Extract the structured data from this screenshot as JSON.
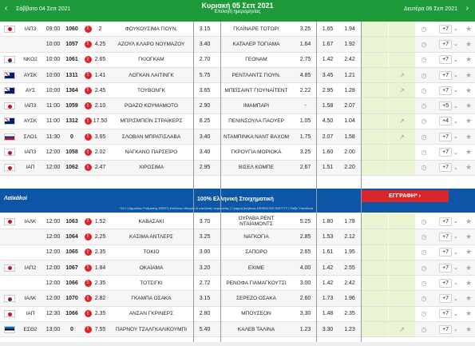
{
  "header": {
    "prev_day": "Σάββατο 04 Σεπ 2021",
    "current_day": "Κυριακή 05 Σεπ 2021",
    "subtitle": "Επιλογή ημερομηνίας",
    "next_day": "Δευτέρα 06 Σεπ 2021",
    "prev_arrow": "‹",
    "next_arrow": "›"
  },
  "rows_top": [
    {
      "flag": "jp",
      "league": "ΙΑΠ3",
      "time": "09:00",
      "code": "1060",
      "cnt": "2",
      "home": "ΦΟΥΚΟΥΣΙΜΑ ΓΙΟΥΝ.",
      "o1": "3.15",
      "away": "ΓΚΑΪΝΑΡΕ ΤΟΤΟΡΙ",
      "ox": "3.25",
      "o2": "1.65",
      "o3": "1.94",
      "pick": "",
      "more": "+7"
    },
    {
      "flag": "",
      "league": "",
      "time": "10:00",
      "code": "1057",
      "cnt": "4.25",
      "home": "ΑΖΟΥΛ ΚΛΑΡΟ ΝΟΥΜΑΖΟΥ",
      "o1": "3.40",
      "away": "ΚΑΤΑΛΕΡ ΤΟΓΙΑΜΑ",
      "ox": "1.64",
      "o2": "1.67",
      "o3": "1.92",
      "pick": "",
      "more": "+7"
    },
    {
      "flag": "kr",
      "league": "ΝΚΟ2",
      "time": "10:00",
      "code": "1061",
      "cnt": "2.65",
      "home": "ΓΚΙΟΓΚΑΜ",
      "o1": "2.70",
      "away": "ΓΕΟΝΑΜ",
      "ox": "2.75",
      "o2": "1.42",
      "o3": "2.42",
      "pick": "",
      "more": "+7"
    },
    {
      "flag": "au",
      "league": "ΑΥΣΚ",
      "time": "10:00",
      "code": "1311",
      "cnt": "1.41",
      "home": "ΛΟΓΚΑΝ ΛΑΙΤΙΝΓΚ",
      "o1": "5.75",
      "away": "ΡΕΝΤΛΑΝΤΣ ΓΙΟΥΝ.",
      "ox": "4.85",
      "o2": "3.45",
      "o3": "1.21",
      "pick": "↗",
      "more": "+7"
    },
    {
      "flag": "au",
      "league": "ΑΥΣ",
      "time": "10:00",
      "code": "1364",
      "cnt": "2.45",
      "home": "ΤΟΥΒΟΝΓΚ",
      "o1": "3.65",
      "away": "ΜΠΕΪΣΑΙΝΤ ΓΙΟΥΝΑΪΤΕΝΤ",
      "ox": "2.22",
      "o2": "2.95",
      "o3": "1.28",
      "pick": "↗",
      "more": "+7"
    },
    {
      "flag": "jp",
      "league": "ΙΑΠ3",
      "time": "11:00",
      "code": "1059",
      "cnt": "2.10",
      "home": "ΡΟΑΖΟ ΚΟΥΜΑΜΟΤΟ",
      "o1": "2.90",
      "away": "ΙΜΑΜΠΑΡΙ",
      "ox": "-",
      "o2": "1.58",
      "o3": "2.07",
      "pick": "",
      "more": "+5"
    },
    {
      "flag": "au",
      "league": "ΑΥΣΚ",
      "time": "11:00",
      "code": "1312",
      "cnt": "17.50",
      "home": "ΜΠΡΙΣΜΠΕΪΝ ΣΤΡΑΪΚΕΡΣ",
      "o1": "8.25",
      "away": "ΠΕΝΙΝΣΟΥΛΑ ΠΑΟΥΕΡ",
      "ox": "1.05",
      "o2": "4.50",
      "o3": "1.04",
      "pick": "↗",
      "more": "+4"
    },
    {
      "flag": "si",
      "league": "ΣΛΟ1",
      "time": "11:30",
      "code": "0",
      "cnt": "3.65",
      "home": "ΣΛΟΒΑΝ ΜΠΡΑΤΙΣΛΑΒΑ",
      "o1": "3.40",
      "away": "ΝΤΑΜΠΙΝΚΑ ΝΑΝΤ ΒΑΧΟΜ",
      "ox": "1.75",
      "o2": "2.07",
      "o3": "1.58",
      "pick": "↗",
      "more": "+7"
    },
    {
      "flag": "jp",
      "league": "ΙΑΠ3",
      "time": "12:00",
      "code": "1058",
      "cnt": "2.02",
      "home": "ΝΑΓΚΑΝΟ ΠΑΡΣΕΪΡΟ",
      "o1": "3.40",
      "away": "ΓΚΡΟΥΓΙΑ ΜΟΡΙΟΚΑ",
      "ox": "3.25",
      "o2": "1.60",
      "o3": "2.00",
      "pick": "",
      "more": "+7"
    },
    {
      "flag": "jp",
      "league": "ΙΑΠ",
      "time": "12:00",
      "code": "1062",
      "cnt": "2.47",
      "home": "ΧΙΡΟΣΙΜΑ",
      "o1": "2.95",
      "away": "ΒΙΣΕΛ ΚΟΜΠΕ",
      "ox": "2.67",
      "o2": "1.51",
      "o3": "2.20",
      "pick": "",
      "more": "+7"
    }
  ],
  "banner": {
    "logo": "Λαϊκάkoi",
    "message": "100% Ελληνική Στοιχηματική",
    "register": "ΕΓΓΡΑΦΗ* ›",
    "fine_print": "*21+ | Αρμόδιος Ρυθμιστής ΕΕΕΠ | Κίνδυνος εθισμού & απώλειας περιουσίας | Γραμμή βοήθειας ΚΕΘΕΑ 210 9237777 | Παίξε Υπεύθυνα"
  },
  "rows_bottom": [
    {
      "flag": "jp",
      "league": "ΙΑΛΚ",
      "time": "12:00",
      "code": "1063",
      "cnt": "1.52",
      "home": "ΚΑΒΑΣΑΚΙ",
      "o1": "3.70",
      "away": "ΟΥΡΑΒΑ ΡΕΝΤ ΝΤΑΪΑΜΟΝΤΣ",
      "ox": "5.25",
      "o2": "1.80",
      "o3": "1.78",
      "pick": "",
      "more": "+7"
    },
    {
      "flag": "",
      "league": "",
      "time": "12:00",
      "code": "1064",
      "cnt": "2.25",
      "home": "ΚΑΣΙΜΑ ΑΝΤΛΕΡΣ",
      "o1": "3.25",
      "away": "ΝΑΓΚΟΓΙΑ",
      "ox": "2.85",
      "o2": "1.53",
      "o3": "2.12",
      "pick": "",
      "more": "+7"
    },
    {
      "flag": "",
      "league": "",
      "time": "12:00",
      "code": "1065",
      "cnt": "2.35",
      "home": "ΤΟΚΙΟ",
      "o1": "3.00",
      "away": "ΣΑΠΟΡΟ",
      "ox": "2.65",
      "o2": "1.61",
      "o3": "1.95",
      "pick": "",
      "more": "+7"
    },
    {
      "flag": "jp",
      "league": "ΙΑΠ2",
      "time": "12:00",
      "code": "1067",
      "cnt": "1.84",
      "home": "ΟΚΑΪΑΜΑ",
      "o1": "3.20",
      "away": "ΕΧΙΜΕ",
      "ox": "4.00",
      "o2": "1.42",
      "o3": "2.55",
      "pick": "",
      "more": "+7"
    },
    {
      "flag": "",
      "league": "",
      "time": "12:00",
      "code": "1066",
      "cnt": "2.35",
      "home": "ΤΟΤΣΙΓΚΙ",
      "o1": "2.72",
      "away": "ΡΕΝΟΦΑ ΓΙΑΜΑΓΚΟΥΤΣΙ",
      "ox": "3.00",
      "o2": "1.42",
      "o3": "2.42",
      "pick": "",
      "more": "+7"
    },
    {
      "flag": "kr",
      "league": "ΙΑΛΚ",
      "time": "12:00",
      "code": "1070",
      "cnt": "2.82",
      "home": "ΓΚΑΜΠΑ ΟΣΑΚΑ",
      "o1": "3.15",
      "away": "ΣΕΡΕΖΟ ΟΣΑΚΑ",
      "ox": "2.60",
      "o2": "1.73",
      "o3": "1.96",
      "pick": "",
      "more": "+7"
    },
    {
      "flag": "jp",
      "league": "ΙΑΠ",
      "time": "12:30",
      "code": "1066",
      "cnt": "2.35",
      "home": "ΑΝΣΑΝ ΓΚΡΙΝΕΡΣ",
      "o1": "2.80",
      "away": "ΜΠΟΥΣΕΟΝ",
      "ox": "3.30",
      "o2": "1.48",
      "o3": "2.35",
      "pick": "",
      "more": "+7"
    },
    {
      "flag": "ee",
      "league": "ΕΣΘ2",
      "time": "13:00",
      "code": "0",
      "cnt": "7.55",
      "home": "ΠΑΡΝΟΥ ΤΖΑΛΓΚΑΛΙΚΟΥΜΠΙ",
      "o1": "5.40",
      "away": "ΚΑΛΕΒ ΤΑΛΙΝΑ",
      "ox": "1.23",
      "o2": "3.30",
      "o3": "1.23",
      "pick": "↗",
      "more": "+7"
    }
  ],
  "icons": {
    "info": "!",
    "stats": "◷",
    "star": "★"
  }
}
